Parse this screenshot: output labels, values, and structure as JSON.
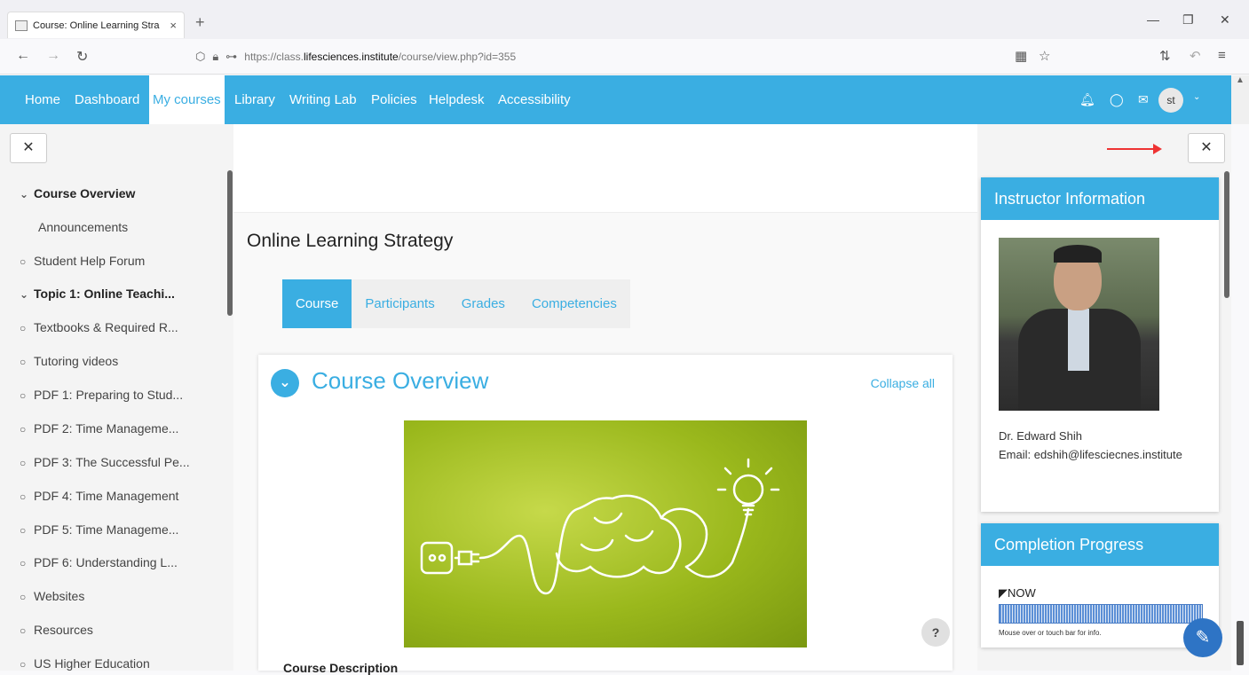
{
  "browser": {
    "tab_title": "Course: Online Learning Stra",
    "tab_close": "×",
    "new_tab": "+",
    "url_prefix": "https://class.",
    "url_host": "lifesciences.institute",
    "url_path": "/course/view.php?id=355"
  },
  "site_nav": {
    "items": [
      "Home",
      "Dashboard",
      "My courses",
      "Library",
      "Writing Lab",
      "Policies",
      "Helpdesk",
      "Accessibility"
    ],
    "active": "My courses",
    "avatar_initials": "st"
  },
  "left_drawer": {
    "items": [
      {
        "label": "Course Overview",
        "mark": "⌄",
        "bold": true
      },
      {
        "label": "Announcements",
        "mark": "",
        "bold": false
      },
      {
        "label": "Student Help Forum",
        "mark": "○",
        "bold": false
      },
      {
        "label": "Topic 1: Online Teachi...",
        "mark": "⌄",
        "bold": true
      },
      {
        "label": "Textbooks & Required R...",
        "mark": "○",
        "bold": false
      },
      {
        "label": "Tutoring videos",
        "mark": "○",
        "bold": false
      },
      {
        "label": "PDF 1: Preparing to Stud...",
        "mark": "○",
        "bold": false
      },
      {
        "label": "PDF 2: Time Manageme...",
        "mark": "○",
        "bold": false
      },
      {
        "label": "PDF 3: The Successful Pe...",
        "mark": "○",
        "bold": false
      },
      {
        "label": "PDF 4: Time Management",
        "mark": "○",
        "bold": false
      },
      {
        "label": "PDF 5: Time Manageme...",
        "mark": "○",
        "bold": false
      },
      {
        "label": "PDF 6: Understanding L...",
        "mark": "○",
        "bold": false
      },
      {
        "label": "Websites",
        "mark": "○",
        "bold": false
      },
      {
        "label": "Resources",
        "mark": "○",
        "bold": false
      },
      {
        "label": "US Higher Education",
        "mark": "○",
        "bold": false
      }
    ]
  },
  "main": {
    "page_title": "Online Learning Strategy",
    "tabs": [
      "Course",
      "Participants",
      "Grades",
      "Competencies"
    ],
    "active_tab": "Course",
    "section_title": "Course Overview",
    "collapse_all": "Collapse all",
    "description_heading": "Course Description",
    "help_label": "?"
  },
  "right_drawer": {
    "instructor": {
      "heading": "Instructor Information",
      "name": "Dr. Edward Shih",
      "email_line": "Email: edshih@lifesciecnes.institute"
    },
    "completion": {
      "heading": "Completion Progress",
      "now_label": "NOW",
      "info": "Mouse over or touch bar for info."
    }
  },
  "colors": {
    "accent": "#3aaee2",
    "arrow": "#e33333"
  }
}
